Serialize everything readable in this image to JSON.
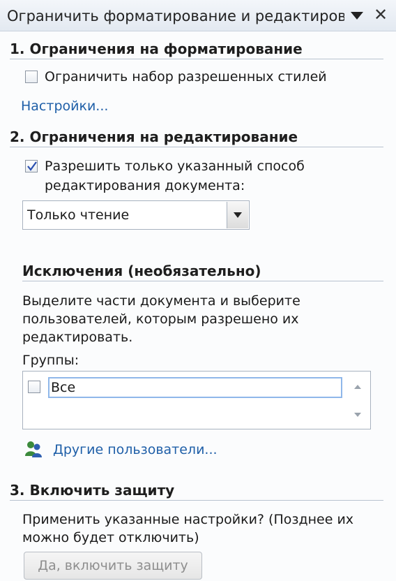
{
  "title": "Ограничить форматирование и редактирования",
  "icons": {
    "dropdown": "triangle-down-icon",
    "close": "close-icon",
    "users": "users-icon"
  },
  "section1": {
    "heading": "1. Ограничения на форматирование",
    "checkbox_label": "Ограничить набор разрешенных стилей",
    "checked": false,
    "settings_link": "Настройки..."
  },
  "section2": {
    "heading": "2. Ограничения на редактирование",
    "checkbox_label_line1": "Разрешить только указанный способ",
    "checkbox_label_line2": "редактирования документа:",
    "checked": true,
    "select_value": "Только чтение"
  },
  "exceptions": {
    "heading": "Исключения (необязательно)",
    "desc_line1": "Выделите части документа и выберите",
    "desc_line2": "пользователей, которым разрешено их",
    "desc_line3": "редактировать.",
    "groups_label": "Группы:",
    "groups": [
      {
        "label": "Все",
        "checked": false
      }
    ],
    "other_users_link": "Другие пользователи..."
  },
  "section3": {
    "heading": "3. Включить защиту",
    "desc_line1": "Применить указанные настройки? (Позднее их",
    "desc_line2": "можно будет отключить)",
    "button_label": "Да, включить защиту",
    "button_enabled": false
  },
  "colors": {
    "link": "#1f5fa8",
    "heading_rule": "#b8c2cf",
    "title_bg": "#e3e9f1"
  }
}
